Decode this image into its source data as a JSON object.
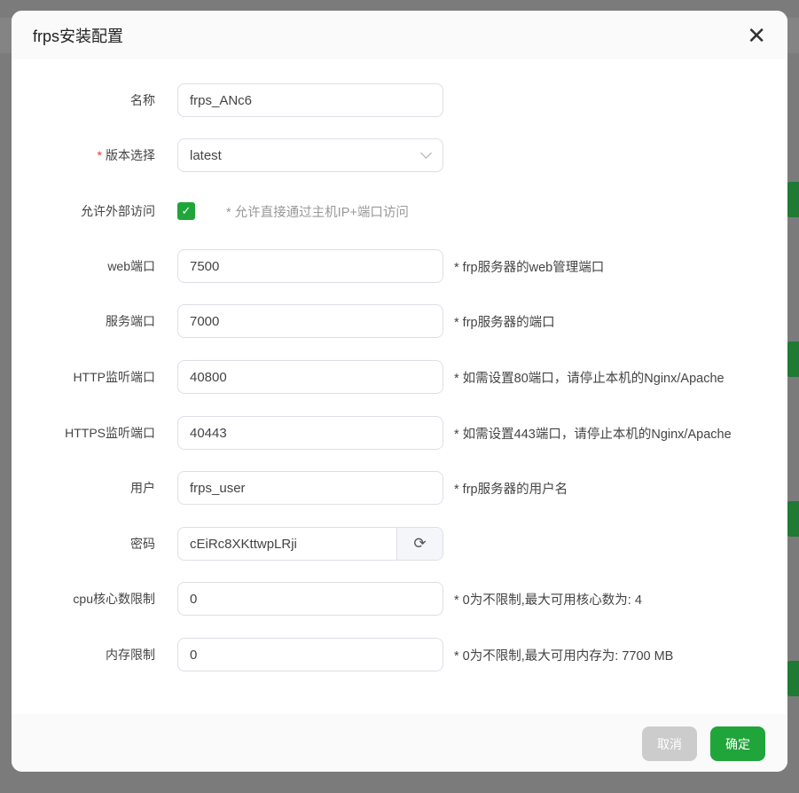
{
  "dialog": {
    "title": "frps安装配置"
  },
  "fields": {
    "name": {
      "label": "名称",
      "value": "frps_ANc6"
    },
    "version": {
      "label": "版本选择",
      "value": "latest",
      "required": "*"
    },
    "external": {
      "label": "允许外部访问",
      "checked": true,
      "hint": "* 允许直接通过主机IP+端口访问"
    },
    "web_port": {
      "label": "web端口",
      "value": "7500",
      "hint": "* frp服务器的web管理端口"
    },
    "service_port": {
      "label": "服务端口",
      "value": "7000",
      "hint": "* frp服务器的端口"
    },
    "http_port": {
      "label": "HTTP监听端口",
      "value": "40800",
      "hint": "* 如需设置80端口，请停止本机的Nginx/Apache"
    },
    "https_port": {
      "label": "HTTPS监听端口",
      "value": "40443",
      "hint": "* 如需设置443端口，请停止本机的Nginx/Apache"
    },
    "user": {
      "label": "用户",
      "value": "frps_user",
      "hint": "* frp服务器的用户名"
    },
    "password": {
      "label": "密码",
      "value": "cEiRc8XKttwpLRji"
    },
    "cpu": {
      "label": "cpu核心数限制",
      "value": "0",
      "hint": "* 0为不限制,最大可用核心数为: 4"
    },
    "memory": {
      "label": "内存限制",
      "value": "0",
      "hint": "* 0为不限制,最大可用内存为: 7700 MB"
    }
  },
  "footer": {
    "cancel": "取消",
    "ok": "确定"
  }
}
